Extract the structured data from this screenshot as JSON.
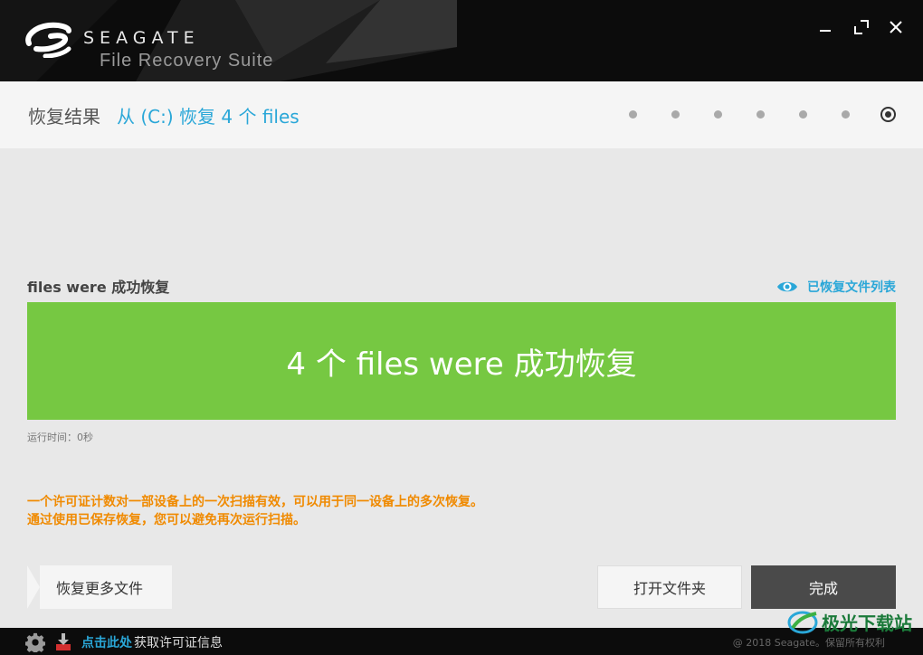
{
  "window": {
    "brand": "SEAGATE",
    "product": "File Recovery Suite",
    "minimize_icon": "minimize-icon",
    "maximize_icon": "maximize-icon",
    "close_icon": "close-icon"
  },
  "header": {
    "label": "恢复结果",
    "path": "从 (C:)  恢复 4 个 files",
    "steps_total": 7,
    "active_step": 7
  },
  "main": {
    "section_title": "files were 成功恢复",
    "view_list_label": "已恢复文件列表",
    "banner_text": "4 个 files were 成功恢复",
    "runtime": "运行时间：0秒",
    "notice_line1": "一个许可证计数对一部设备上的一次扫描有效，可以用于同一设备上的多次恢复。",
    "notice_line2": "通过使用已保存恢复，您可以避免再次运行扫描。"
  },
  "buttons": {
    "back": "恢复更多文件",
    "open_folder": "打开文件夹",
    "done": "完成"
  },
  "footer": {
    "link": "点击此处",
    "info": "获取许可证信息",
    "copyright": "@ 2018 Seagate。保留所有权利"
  },
  "watermark": {
    "text": "极光下载站"
  },
  "colors": {
    "accent": "#2aa7d8",
    "success": "#76c842",
    "warning": "#f08a00",
    "titlebar": "#0c0c0c"
  }
}
